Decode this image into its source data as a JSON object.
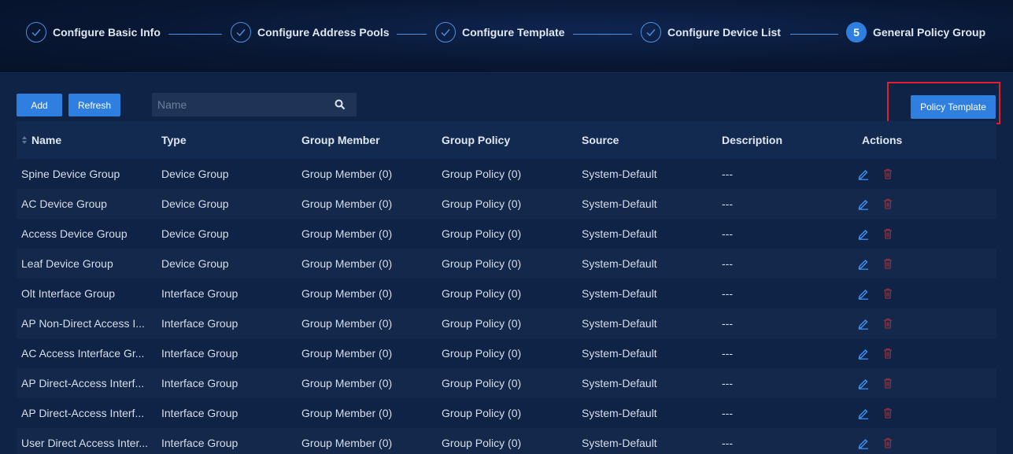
{
  "steps": [
    {
      "label": "Configure Basic Info",
      "status": "done"
    },
    {
      "label": "Configure Address Pools",
      "status": "done"
    },
    {
      "label": "Configure Template",
      "status": "done"
    },
    {
      "label": "Configure Device List",
      "status": "done"
    },
    {
      "label": "General Policy Group",
      "status": "active",
      "number": "5"
    }
  ],
  "toolbar": {
    "add_label": "Add",
    "refresh_label": "Refresh",
    "search_placeholder": "Name",
    "policy_template_label": "Policy Template"
  },
  "table": {
    "headers": [
      "Name",
      "Type",
      "Group Member",
      "Group Policy",
      "Source",
      "Description",
      "Actions"
    ],
    "rows": [
      {
        "name": "Spine Device Group",
        "type": "Device Group",
        "member": "Group Member (0)",
        "policy": "Group Policy (0)",
        "source": "System-Default",
        "description": "---"
      },
      {
        "name": "AC Device Group",
        "type": "Device Group",
        "member": "Group Member (0)",
        "policy": "Group Policy (0)",
        "source": "System-Default",
        "description": "---"
      },
      {
        "name": "Access Device Group",
        "type": "Device Group",
        "member": "Group Member (0)",
        "policy": "Group Policy (0)",
        "source": "System-Default",
        "description": "---"
      },
      {
        "name": "Leaf Device Group",
        "type": "Device Group",
        "member": "Group Member (0)",
        "policy": "Group Policy (0)",
        "source": "System-Default",
        "description": "---"
      },
      {
        "name": "Olt Interface Group",
        "type": "Interface Group",
        "member": "Group Member (0)",
        "policy": "Group Policy (0)",
        "source": "System-Default",
        "description": "---"
      },
      {
        "name": "AP Non-Direct Access I...",
        "type": "Interface Group",
        "member": "Group Member (0)",
        "policy": "Group Policy (0)",
        "source": "System-Default",
        "description": "---"
      },
      {
        "name": "AC Access Interface Gr...",
        "type": "Interface Group",
        "member": "Group Member (0)",
        "policy": "Group Policy (0)",
        "source": "System-Default",
        "description": "---"
      },
      {
        "name": "AP Direct-Access Interf...",
        "type": "Interface Group",
        "member": "Group Member (0)",
        "policy": "Group Policy (0)",
        "source": "System-Default",
        "description": "---"
      },
      {
        "name": "AP Direct-Access Interf...",
        "type": "Interface Group",
        "member": "Group Member (0)",
        "policy": "Group Policy (0)",
        "source": "System-Default",
        "description": "---"
      },
      {
        "name": "User Direct Access Inter...",
        "type": "Interface Group",
        "member": "Group Member (0)",
        "policy": "Group Policy (0)",
        "source": "System-Default",
        "description": "---"
      }
    ]
  },
  "colors": {
    "accent": "#2f7fe0",
    "edit_icon": "#3b8ff0",
    "delete_icon": "#8a3340",
    "highlight": "#e0202c"
  }
}
